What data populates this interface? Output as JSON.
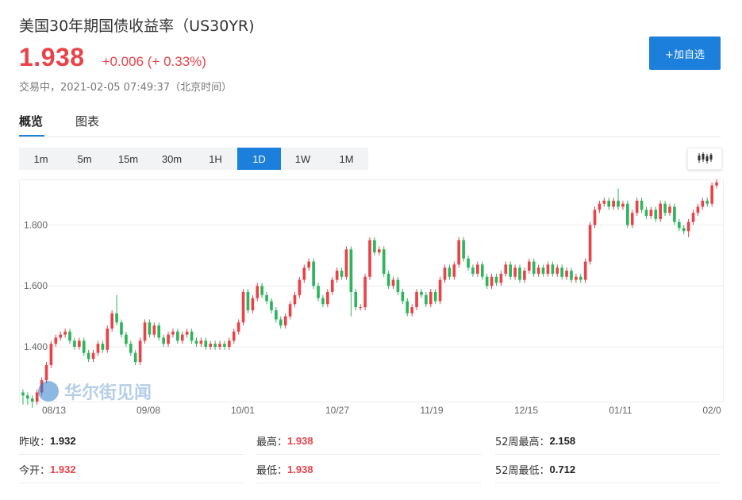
{
  "header": {
    "title": "美国30年期国债收益率（US30YR)",
    "price": "1.938",
    "change": "+0.006 (+ 0.33%)",
    "status": "交易中，2021-02-05 07:49:37（北京时间）",
    "add_button": "+加自选"
  },
  "tabs": [
    {
      "label": "概览",
      "active": true
    },
    {
      "label": "图表",
      "active": false
    }
  ],
  "periods": [
    {
      "label": "1m"
    },
    {
      "label": "5m"
    },
    {
      "label": "15m"
    },
    {
      "label": "30m"
    },
    {
      "label": "1H"
    },
    {
      "label": "1D",
      "active": true
    },
    {
      "label": "1W"
    },
    {
      "label": "1M"
    }
  ],
  "toolbar": {
    "chart_type_icon": "candlestick-icon"
  },
  "watermark": "华尔街见闻",
  "colors": {
    "up": "#e9434a",
    "down": "#2db55d",
    "accent": "#1b7fdb"
  },
  "chart_data": {
    "type": "candlestick",
    "ylim": [
      1.22,
      1.95
    ],
    "yticks": [
      "1.400",
      "1.600",
      "1.800"
    ],
    "xticks": [
      "08/13",
      "09/08",
      "10/01",
      "10/27",
      "11/19",
      "12/15",
      "01/11",
      "02/0"
    ],
    "candles": [
      [
        1.25,
        1.24,
        1.26,
        1.21
      ],
      [
        1.24,
        1.23,
        1.25,
        1.21
      ],
      [
        1.23,
        1.22,
        1.24,
        1.2
      ],
      [
        1.22,
        1.25,
        1.26,
        1.21
      ],
      [
        1.25,
        1.29,
        1.3,
        1.24
      ],
      [
        1.29,
        1.34,
        1.35,
        1.28
      ],
      [
        1.34,
        1.41,
        1.42,
        1.33
      ],
      [
        1.41,
        1.43,
        1.44,
        1.4
      ],
      [
        1.43,
        1.44,
        1.45,
        1.42
      ],
      [
        1.44,
        1.45,
        1.46,
        1.43
      ],
      [
        1.45,
        1.42,
        1.46,
        1.41
      ],
      [
        1.42,
        1.4,
        1.43,
        1.39
      ],
      [
        1.4,
        1.42,
        1.43,
        1.39
      ],
      [
        1.42,
        1.38,
        1.43,
        1.37
      ],
      [
        1.38,
        1.36,
        1.39,
        1.35
      ],
      [
        1.36,
        1.38,
        1.39,
        1.35
      ],
      [
        1.38,
        1.41,
        1.42,
        1.37
      ],
      [
        1.41,
        1.39,
        1.42,
        1.38
      ],
      [
        1.39,
        1.46,
        1.47,
        1.38
      ],
      [
        1.46,
        1.51,
        1.52,
        1.45
      ],
      [
        1.51,
        1.48,
        1.57,
        1.47
      ],
      [
        1.48,
        1.44,
        1.49,
        1.43
      ],
      [
        1.44,
        1.41,
        1.45,
        1.4
      ],
      [
        1.41,
        1.38,
        1.42,
        1.37
      ],
      [
        1.38,
        1.35,
        1.39,
        1.34
      ],
      [
        1.35,
        1.42,
        1.43,
        1.34
      ],
      [
        1.42,
        1.48,
        1.49,
        1.41
      ],
      [
        1.48,
        1.44,
        1.49,
        1.43
      ],
      [
        1.44,
        1.47,
        1.48,
        1.43
      ],
      [
        1.47,
        1.43,
        1.48,
        1.42
      ],
      [
        1.43,
        1.41,
        1.44,
        1.4
      ],
      [
        1.41,
        1.44,
        1.45,
        1.4
      ],
      [
        1.44,
        1.45,
        1.46,
        1.43
      ],
      [
        1.45,
        1.42,
        1.46,
        1.41
      ],
      [
        1.42,
        1.44,
        1.45,
        1.41
      ],
      [
        1.44,
        1.45,
        1.46,
        1.43
      ],
      [
        1.45,
        1.42,
        1.46,
        1.41
      ],
      [
        1.42,
        1.41,
        1.43,
        1.4
      ],
      [
        1.41,
        1.42,
        1.43,
        1.4
      ],
      [
        1.42,
        1.4,
        1.43,
        1.39
      ],
      [
        1.4,
        1.41,
        1.42,
        1.39
      ],
      [
        1.41,
        1.4,
        1.42,
        1.39
      ],
      [
        1.4,
        1.41,
        1.42,
        1.39
      ],
      [
        1.41,
        1.4,
        1.42,
        1.39
      ],
      [
        1.4,
        1.42,
        1.43,
        1.39
      ],
      [
        1.42,
        1.45,
        1.46,
        1.41
      ],
      [
        1.45,
        1.48,
        1.49,
        1.44
      ],
      [
        1.48,
        1.58,
        1.59,
        1.47
      ],
      [
        1.58,
        1.52,
        1.59,
        1.51
      ],
      [
        1.52,
        1.56,
        1.57,
        1.51
      ],
      [
        1.56,
        1.6,
        1.61,
        1.55
      ],
      [
        1.6,
        1.57,
        1.61,
        1.56
      ],
      [
        1.57,
        1.55,
        1.58,
        1.54
      ],
      [
        1.55,
        1.52,
        1.56,
        1.51
      ],
      [
        1.52,
        1.49,
        1.53,
        1.48
      ],
      [
        1.49,
        1.47,
        1.5,
        1.46
      ],
      [
        1.47,
        1.5,
        1.51,
        1.46
      ],
      [
        1.5,
        1.54,
        1.55,
        1.49
      ],
      [
        1.54,
        1.57,
        1.58,
        1.53
      ],
      [
        1.57,
        1.62,
        1.63,
        1.56
      ],
      [
        1.62,
        1.66,
        1.67,
        1.61
      ],
      [
        1.66,
        1.68,
        1.69,
        1.65
      ],
      [
        1.68,
        1.6,
        1.69,
        1.59
      ],
      [
        1.6,
        1.56,
        1.61,
        1.55
      ],
      [
        1.56,
        1.54,
        1.57,
        1.53
      ],
      [
        1.54,
        1.58,
        1.59,
        1.53
      ],
      [
        1.58,
        1.62,
        1.63,
        1.57
      ],
      [
        1.62,
        1.65,
        1.66,
        1.61
      ],
      [
        1.65,
        1.63,
        1.66,
        1.62
      ],
      [
        1.63,
        1.72,
        1.73,
        1.62
      ],
      [
        1.72,
        1.58,
        1.73,
        1.5
      ],
      [
        1.58,
        1.53,
        1.59,
        1.52
      ],
      [
        1.53,
        1.53,
        1.54,
        1.52
      ],
      [
        1.53,
        1.63,
        1.64,
        1.52
      ],
      [
        1.63,
        1.75,
        1.76,
        1.62
      ],
      [
        1.75,
        1.71,
        1.76,
        1.7
      ],
      [
        1.71,
        1.72,
        1.73,
        1.7
      ],
      [
        1.72,
        1.64,
        1.73,
        1.63
      ],
      [
        1.64,
        1.6,
        1.65,
        1.59
      ],
      [
        1.6,
        1.62,
        1.63,
        1.59
      ],
      [
        1.62,
        1.58,
        1.63,
        1.57
      ],
      [
        1.58,
        1.55,
        1.59,
        1.54
      ],
      [
        1.55,
        1.51,
        1.56,
        1.5
      ],
      [
        1.51,
        1.53,
        1.54,
        1.5
      ],
      [
        1.53,
        1.58,
        1.59,
        1.52
      ],
      [
        1.58,
        1.57,
        1.59,
        1.56
      ],
      [
        1.57,
        1.54,
        1.58,
        1.53
      ],
      [
        1.54,
        1.58,
        1.59,
        1.53
      ],
      [
        1.58,
        1.55,
        1.59,
        1.54
      ],
      [
        1.55,
        1.62,
        1.63,
        1.54
      ],
      [
        1.62,
        1.66,
        1.67,
        1.61
      ],
      [
        1.66,
        1.63,
        1.67,
        1.62
      ],
      [
        1.63,
        1.67,
        1.68,
        1.62
      ],
      [
        1.67,
        1.75,
        1.76,
        1.66
      ],
      [
        1.75,
        1.69,
        1.76,
        1.68
      ],
      [
        1.69,
        1.66,
        1.7,
        1.65
      ],
      [
        1.66,
        1.64,
        1.67,
        1.63
      ],
      [
        1.64,
        1.67,
        1.68,
        1.63
      ],
      [
        1.67,
        1.63,
        1.68,
        1.62
      ],
      [
        1.63,
        1.6,
        1.64,
        1.59
      ],
      [
        1.6,
        1.63,
        1.64,
        1.59
      ],
      [
        1.63,
        1.61,
        1.64,
        1.6
      ],
      [
        1.61,
        1.64,
        1.65,
        1.6
      ],
      [
        1.64,
        1.67,
        1.68,
        1.63
      ],
      [
        1.67,
        1.63,
        1.68,
        1.62
      ],
      [
        1.63,
        1.66,
        1.67,
        1.62
      ],
      [
        1.66,
        1.62,
        1.67,
        1.61
      ],
      [
        1.62,
        1.65,
        1.66,
        1.61
      ],
      [
        1.65,
        1.68,
        1.69,
        1.64
      ],
      [
        1.68,
        1.64,
        1.69,
        1.63
      ],
      [
        1.64,
        1.66,
        1.67,
        1.63
      ],
      [
        1.66,
        1.64,
        1.67,
        1.63
      ],
      [
        1.64,
        1.67,
        1.68,
        1.63
      ],
      [
        1.67,
        1.64,
        1.68,
        1.63
      ],
      [
        1.64,
        1.66,
        1.67,
        1.63
      ],
      [
        1.66,
        1.63,
        1.67,
        1.62
      ],
      [
        1.63,
        1.65,
        1.66,
        1.62
      ],
      [
        1.65,
        1.62,
        1.66,
        1.61
      ],
      [
        1.62,
        1.63,
        1.64,
        1.61
      ],
      [
        1.63,
        1.62,
        1.64,
        1.61
      ],
      [
        1.62,
        1.68,
        1.69,
        1.61
      ],
      [
        1.68,
        1.8,
        1.81,
        1.67
      ],
      [
        1.8,
        1.85,
        1.86,
        1.79
      ],
      [
        1.85,
        1.87,
        1.88,
        1.84
      ],
      [
        1.87,
        1.88,
        1.89,
        1.86
      ],
      [
        1.88,
        1.86,
        1.89,
        1.85
      ],
      [
        1.86,
        1.88,
        1.89,
        1.85
      ],
      [
        1.88,
        1.86,
        1.92,
        1.85
      ],
      [
        1.86,
        1.87,
        1.88,
        1.85
      ],
      [
        1.87,
        1.8,
        1.88,
        1.79
      ],
      [
        1.8,
        1.84,
        1.85,
        1.79
      ],
      [
        1.84,
        1.88,
        1.89,
        1.83
      ],
      [
        1.88,
        1.85,
        1.89,
        1.84
      ],
      [
        1.85,
        1.83,
        1.86,
        1.82
      ],
      [
        1.83,
        1.85,
        1.86,
        1.82
      ],
      [
        1.85,
        1.82,
        1.86,
        1.81
      ],
      [
        1.82,
        1.87,
        1.88,
        1.81
      ],
      [
        1.87,
        1.84,
        1.88,
        1.83
      ],
      [
        1.84,
        1.86,
        1.87,
        1.83
      ],
      [
        1.86,
        1.81,
        1.87,
        1.8
      ],
      [
        1.81,
        1.79,
        1.82,
        1.78
      ],
      [
        1.79,
        1.78,
        1.8,
        1.77
      ],
      [
        1.78,
        1.81,
        1.82,
        1.76
      ],
      [
        1.81,
        1.84,
        1.85,
        1.8
      ],
      [
        1.84,
        1.86,
        1.87,
        1.83
      ],
      [
        1.86,
        1.88,
        1.89,
        1.85
      ],
      [
        1.88,
        1.87,
        1.89,
        1.86
      ],
      [
        1.87,
        1.93,
        1.94,
        1.86
      ],
      [
        1.93,
        1.94,
        1.95,
        1.92
      ]
    ]
  },
  "stats": [
    {
      "label": "昨收：",
      "value": "1.932",
      "tone": "dark"
    },
    {
      "label": "最高：",
      "value": "1.938",
      "tone": "red"
    },
    {
      "label": "52周最高：",
      "value": "2.158",
      "tone": "dark"
    },
    {
      "label": "今开：",
      "value": "1.932",
      "tone": "red"
    },
    {
      "label": "最低：",
      "value": "1.938",
      "tone": "red"
    },
    {
      "label": "52周最低：",
      "value": "0.712",
      "tone": "dark"
    }
  ]
}
